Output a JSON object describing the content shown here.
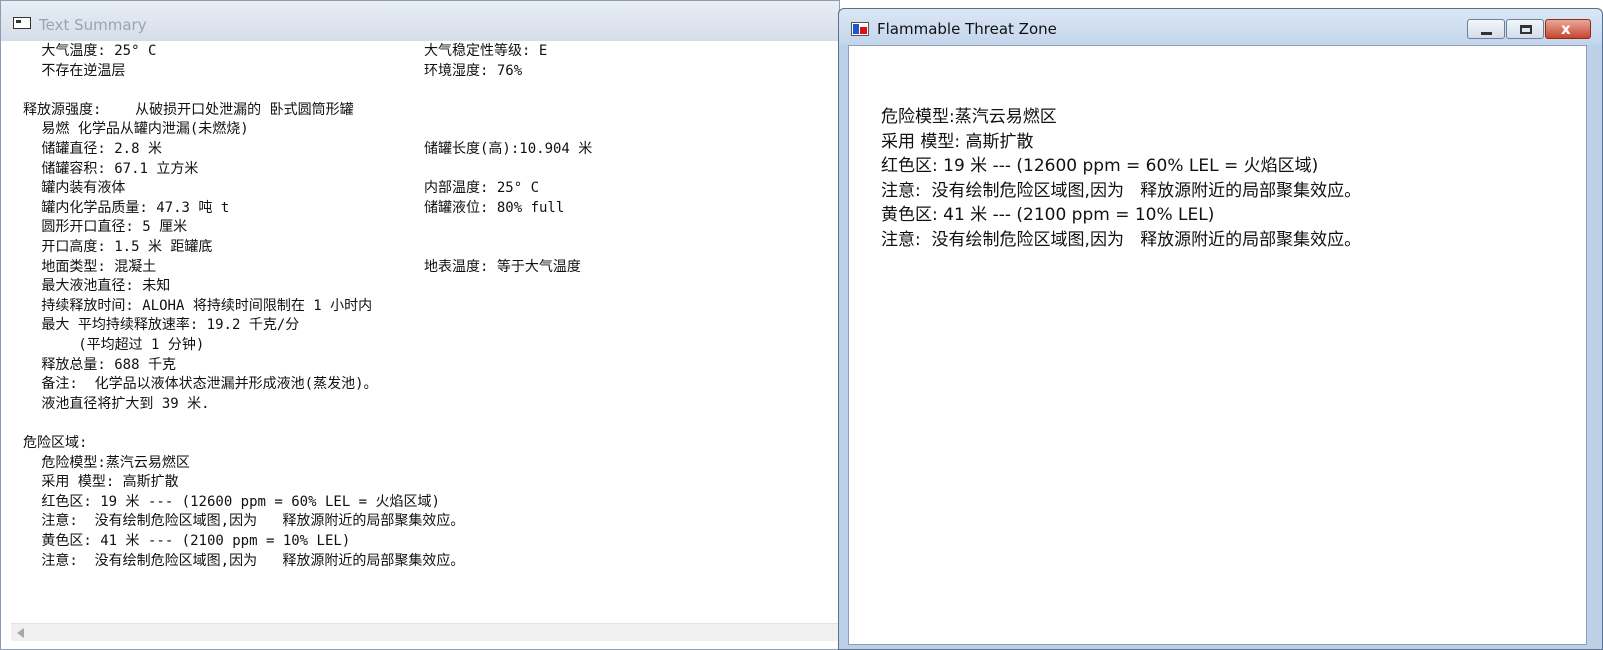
{
  "left_window": {
    "title": "Text Summary",
    "lines": [
      {
        "indent": 2,
        "text": "大气温度: 25° C",
        "right": "大气稳定性等级: E"
      },
      {
        "indent": 2,
        "text": "不存在逆温层",
        "right": "环境湿度: 76%"
      },
      {
        "indent": 0,
        "text": "",
        "right": ""
      },
      {
        "indent": 0,
        "text": "释放源强度:    从破损开口处泄漏的 卧式圆筒形罐",
        "right": ""
      },
      {
        "indent": 2,
        "text": "易燃 化学品从罐内泄漏(未燃烧)",
        "right": ""
      },
      {
        "indent": 2,
        "text": "储罐直径: 2.8 米",
        "right": "储罐长度(高):10.904 米"
      },
      {
        "indent": 2,
        "text": "储罐容积: 67.1 立方米",
        "right": ""
      },
      {
        "indent": 2,
        "text": "罐内装有液体",
        "right": "内部温度: 25° C"
      },
      {
        "indent": 2,
        "text": "罐内化学品质量: 47.3 吨 t",
        "right": "储罐液位: 80% full"
      },
      {
        "indent": 2,
        "text": "圆形开口直径: 5 厘米",
        "right": ""
      },
      {
        "indent": 2,
        "text": "开口高度: 1.5 米 距罐底",
        "right": ""
      },
      {
        "indent": 2,
        "text": "地面类型: 混凝土",
        "right": "地表温度: 等于大气温度"
      },
      {
        "indent": 2,
        "text": "最大液池直径: 未知",
        "right": ""
      },
      {
        "indent": 2,
        "text": "持续释放时间: ALOHA 将持续时间限制在 1 小时内",
        "right": ""
      },
      {
        "indent": 2,
        "text": "最大 平均持续释放速率: 19.2 千克/分",
        "right": ""
      },
      {
        "indent": 6,
        "text": "(平均超过 1 分钟)",
        "right": ""
      },
      {
        "indent": 2,
        "text": "释放总量: 688 千克",
        "right": ""
      },
      {
        "indent": 2,
        "text": "备注:  化学品以液体状态泄漏并形成液池(蒸发池)。",
        "right": ""
      },
      {
        "indent": 2,
        "text": "液池直径将扩大到 39 米.",
        "right": ""
      },
      {
        "indent": 0,
        "text": "",
        "right": ""
      },
      {
        "indent": 0,
        "text": "危险区域:",
        "right": ""
      },
      {
        "indent": 2,
        "text": "危险模型:蒸汽云易燃区",
        "right": ""
      },
      {
        "indent": 2,
        "text": "采用 模型: 高斯扩散",
        "right": ""
      },
      {
        "indent": 2,
        "text": "红色区: 19 米 --- (12600 ppm = 60% LEL = 火焰区域)",
        "right": ""
      },
      {
        "indent": 2,
        "text": "注意:  没有绘制危险区域图,因为   释放源附近的局部聚集效应。",
        "right": ""
      },
      {
        "indent": 2,
        "text": "黄色区: 41 米 --- (2100 ppm = 10% LEL)",
        "right": ""
      },
      {
        "indent": 2,
        "text": "注意:  没有绘制危险区域图,因为   释放源附近的局部聚集效应。",
        "right": ""
      }
    ]
  },
  "right_window": {
    "title": "Flammable Threat Zone",
    "close_glyph": "x",
    "lines": [
      "危险模型:蒸汽云易燃区",
      "采用 模型: 高斯扩散",
      "红色区: 19 米 --- (12600 ppm = 60% LEL = 火焰区域)",
      "注意:  没有绘制危险区域图,因为   释放源附近的局部聚集效应。",
      "黄色区: 41 米 --- (2100 ppm = 10% LEL)",
      "注意:  没有绘制危险区域图,因为   释放源附近的局部聚集效应。"
    ]
  }
}
